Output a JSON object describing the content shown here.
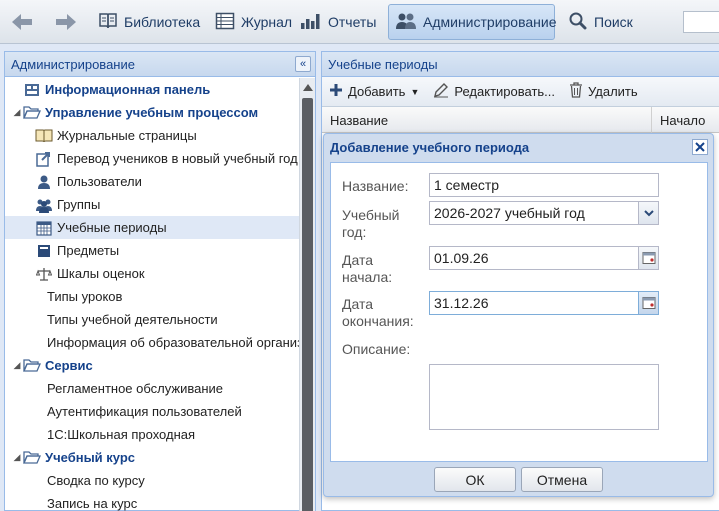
{
  "toolbar": {
    "items": [
      {
        "label": "Библиотека",
        "icon": "book-icon"
      },
      {
        "label": "Журнал",
        "icon": "table-icon"
      },
      {
        "label": "Отчеты",
        "icon": "bar-chart-icon"
      },
      {
        "label": "Администрирование",
        "icon": "users-icon"
      },
      {
        "label": "Поиск",
        "icon": "search-icon"
      }
    ]
  },
  "left_panel": {
    "title": "Администрирование",
    "tree": [
      {
        "label": "Информационная панель",
        "icon": "dashboard-icon"
      },
      {
        "label": "Управление учебным процессом",
        "icon": "folder-open-icon"
      },
      {
        "label": "Журнальные страницы",
        "icon": "journal-icon"
      },
      {
        "label": "Перевод учеников в новый учебный год",
        "icon": "transfer-icon"
      },
      {
        "label": "Пользователи",
        "icon": "user-icon"
      },
      {
        "label": "Группы",
        "icon": "group-icon"
      },
      {
        "label": "Учебные периоды",
        "icon": "calendar-icon"
      },
      {
        "label": "Предметы",
        "icon": "book-icon"
      },
      {
        "label": "Шкалы оценок",
        "icon": "scales-icon"
      },
      {
        "label": "Типы уроков"
      },
      {
        "label": "Типы учебной деятельности"
      },
      {
        "label": "Информация об образовательной организации"
      },
      {
        "label": "Сервис",
        "icon": "folder-open-icon"
      },
      {
        "label": "Регламентное обслуживание"
      },
      {
        "label": "Аутентификация пользователей"
      },
      {
        "label": "1С:Школьная проходная"
      },
      {
        "label": "Учебный курс",
        "icon": "folder-open-icon"
      },
      {
        "label": "Сводка по курсу"
      },
      {
        "label": "Запись на курс"
      }
    ]
  },
  "right_panel": {
    "title": "Учебные периоды",
    "add_label": "Добавить",
    "edit_label": "Редактировать...",
    "delete_label": "Удалить",
    "columns": [
      "Название",
      "Начало"
    ]
  },
  "dialog": {
    "title": "Добавление учебного периода",
    "name_label": "Название:",
    "name_value": "1 семестр",
    "year_label_1": "Учебный",
    "year_label_2": "год:",
    "year_value": "2026-2027 учебный год",
    "start_label_1": "Дата",
    "start_label_2": "начала:",
    "start_value": "01.09.26",
    "end_label_1": "Дата",
    "end_label_2": "окончания:",
    "end_value": "31.12.26",
    "description_label": "Описание:",
    "ok_label": "ОК",
    "cancel_label": "Отмена"
  },
  "colors": {
    "header_text": "#15428b",
    "panel_border": "#99bbe8",
    "selected_row": "#dfe8f6"
  }
}
